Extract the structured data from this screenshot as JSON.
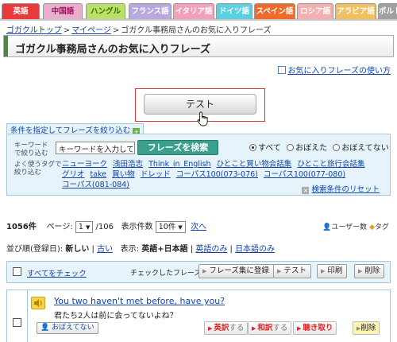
{
  "lang_tabs": [
    {
      "label": "英語",
      "color": "#e83a3a",
      "text": "#ffffff"
    },
    {
      "label": "中国語",
      "color": "#e8b0cc",
      "text": "#a01060"
    },
    {
      "label": "ハングル",
      "color": "#b8e06a",
      "text": "#3a6a00"
    },
    {
      "label": "フランス語",
      "color": "#b8a8e0",
      "text": "#ffffff"
    },
    {
      "label": "イタリア語",
      "color": "#f4a0b8",
      "text": "#ffffff"
    },
    {
      "label": "ドイツ語",
      "color": "#5ad0e0",
      "text": "#ffffff"
    },
    {
      "label": "スペイン語",
      "color": "#f06a2a",
      "text": "#ffffff"
    },
    {
      "label": "ロシア語",
      "color": "#f4b0b0",
      "text": "#ffffff"
    },
    {
      "label": "アラビア語",
      "color": "#f0c060",
      "text": "#ffffff"
    },
    {
      "label": "ポルトガ",
      "color": "#a0a0a0",
      "text": "#ffffff"
    }
  ],
  "breadcrumb": {
    "items": [
      "ゴガクルトップ",
      "マイページ"
    ],
    "current": "ゴガクル事務局さんのお気に入りフレーズ",
    "separator": ">"
  },
  "page_title": "ゴガクル事務局さんのお気に入りフレーズ",
  "howto_link": "お気に入りフレーズの使い方",
  "test_button": "テスト",
  "filter": {
    "tab_label": "条件を指定してフレーズを絞り込む",
    "keyword_label": "キーワードで絞り込む",
    "keyword_value": "キーワードを入力して",
    "search_button": "フレーズを検索",
    "radio_options": [
      "すべて",
      "おぼえた",
      "おぼえてない"
    ],
    "radio_selected": "すべて",
    "tag_label": "よく使うタグで絞り込む",
    "tags": [
      "ニューヨーク",
      "浅田浩志",
      "Think_in_English",
      "ひとこと買い物会話集",
      "ひとこと旅行会話集",
      "グリオ",
      "take",
      "買い物",
      "ドレッド",
      "コーパス100(073-076)",
      "コーパス100(077-080)",
      "コーパス(081-084)"
    ],
    "reset_link": "検索条件のリセット"
  },
  "results": {
    "count": "1056件",
    "page_label": "ページ:",
    "page_value": "1",
    "page_total": "/106",
    "per_page_label": "表示件数",
    "per_page_value": "10件",
    "next_link": "次へ",
    "user_count_label": "ユーザー数",
    "tag_label": "タグ"
  },
  "sort": {
    "label": "並び順(登録日):",
    "newest": "新しい",
    "oldest": "古い",
    "display_label": "表示:",
    "display_current": "英語+日本語",
    "english_only": "英語のみ",
    "japanese_only": "日本語のみ"
  },
  "actions": {
    "check_all": "すべてをチェック",
    "checked_label": "チェックしたフレーズを",
    "register": "フレーズ集に登録",
    "test": "テスト",
    "print": "印刷",
    "delete": "削除"
  },
  "phrase": {
    "english": "You two haven't met before, have you?",
    "japanese": "君たち2人は前に会ってないよね？",
    "memorized": "おぼえてない",
    "btn_en": "英訳",
    "btn_jp": "和訳",
    "btn_listen": "聴き取り",
    "suru": "する",
    "delete": "削除"
  }
}
